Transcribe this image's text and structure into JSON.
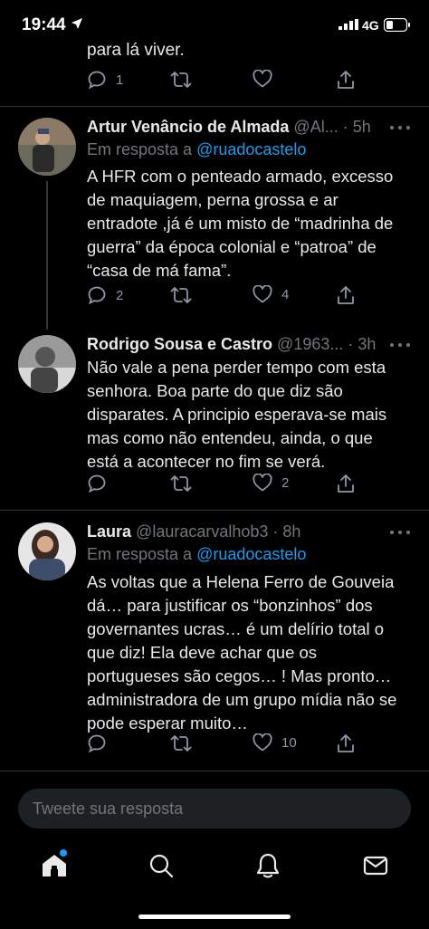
{
  "status": {
    "time": "19:44",
    "network": "4G"
  },
  "top_partial": {
    "text": "para lá viver.",
    "reply_count": "1"
  },
  "tweets": [
    {
      "name": "Artur Venâncio de Almada",
      "meta": "@Al... · 5h",
      "reply_prefix": "Em resposta a",
      "reply_handle": "@ruadocastelo",
      "lines": [
        "A HFR com o penteado armado, excesso",
        "de maquiagem, perna grossa e ar",
        "entradote ,já é um misto de “madrinha de",
        "guerra” da época colonial e “patroa” de",
        "“casa de má fama”."
      ],
      "reply_count": "2",
      "like_count": "4"
    },
    {
      "name": "Rodrigo Sousa e Castro",
      "meta": "@1963... · 3h",
      "lines": [
        "Não vale a pena perder tempo com esta",
        "senhora. Boa parte do que diz são",
        "disparates. A principio esperava-se mais",
        "mas como não entendeu, ainda, o que",
        "está  a acontecer no fim se verá."
      ],
      "reply_count": "",
      "like_count": "2"
    },
    {
      "name": "Laura",
      "meta": "@lauracarvalhob3 · 8h",
      "reply_prefix": "Em resposta a",
      "reply_handle": "@ruadocastelo",
      "lines": [
        "As voltas que a Helena Ferro de Gouveia",
        "dá… para justificar os “bonzinhos” dos",
        "governantes ucras… é um delírio total o",
        "que diz! Ela deve achar que os",
        "portugueses são cegos… ! Mas pronto…",
        "administradora de um grupo mídia não se",
        "pode esperar muito…"
      ],
      "reply_count": "",
      "like_count": "10"
    }
  ],
  "reply_input": {
    "placeholder": "Tweete sua resposta"
  },
  "colors": {
    "background": "#000000",
    "accent": "#1d9bf0",
    "muted": "#71767b",
    "text": "#e7e9ea"
  }
}
